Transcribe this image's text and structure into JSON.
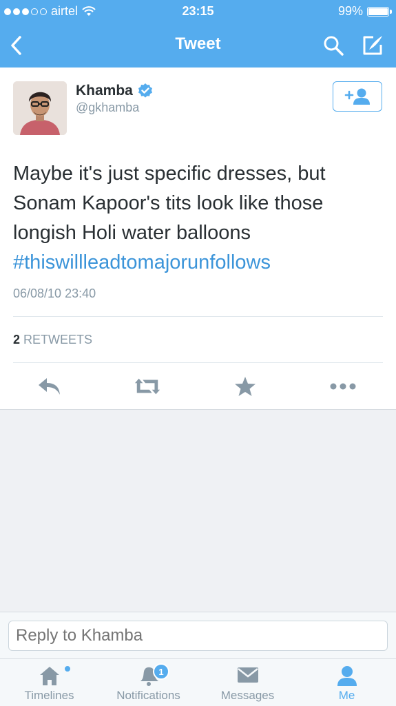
{
  "status_bar": {
    "carrier": "airtel",
    "time": "23:15",
    "battery": "99%",
    "signal_bars": 3,
    "signal_total": 5
  },
  "nav": {
    "title": "Tweet"
  },
  "tweet": {
    "author_name": "Khamba",
    "handle": "@gkhamba",
    "text": "Maybe it's just specific dresses, but Sonam Kapoor's tits look like those longish Holi water balloons",
    "hashtag": "#thiswillleadtomajorunfollows",
    "timestamp": "06/08/10 23:40",
    "retweet_count": "2",
    "retweet_label": "RETWEETS"
  },
  "reply": {
    "placeholder": "Reply to Khamba"
  },
  "tabs": [
    {
      "label": "Timelines",
      "icon": "home-icon"
    },
    {
      "label": "Notifications",
      "icon": "bell-icon",
      "badge": "1"
    },
    {
      "label": "Messages",
      "icon": "envelope-icon"
    },
    {
      "label": "Me",
      "icon": "person-icon"
    }
  ],
  "colors": {
    "brand": "#55acee",
    "link": "#3b94d9",
    "text": "#292f33",
    "muted": "#8899a6"
  }
}
